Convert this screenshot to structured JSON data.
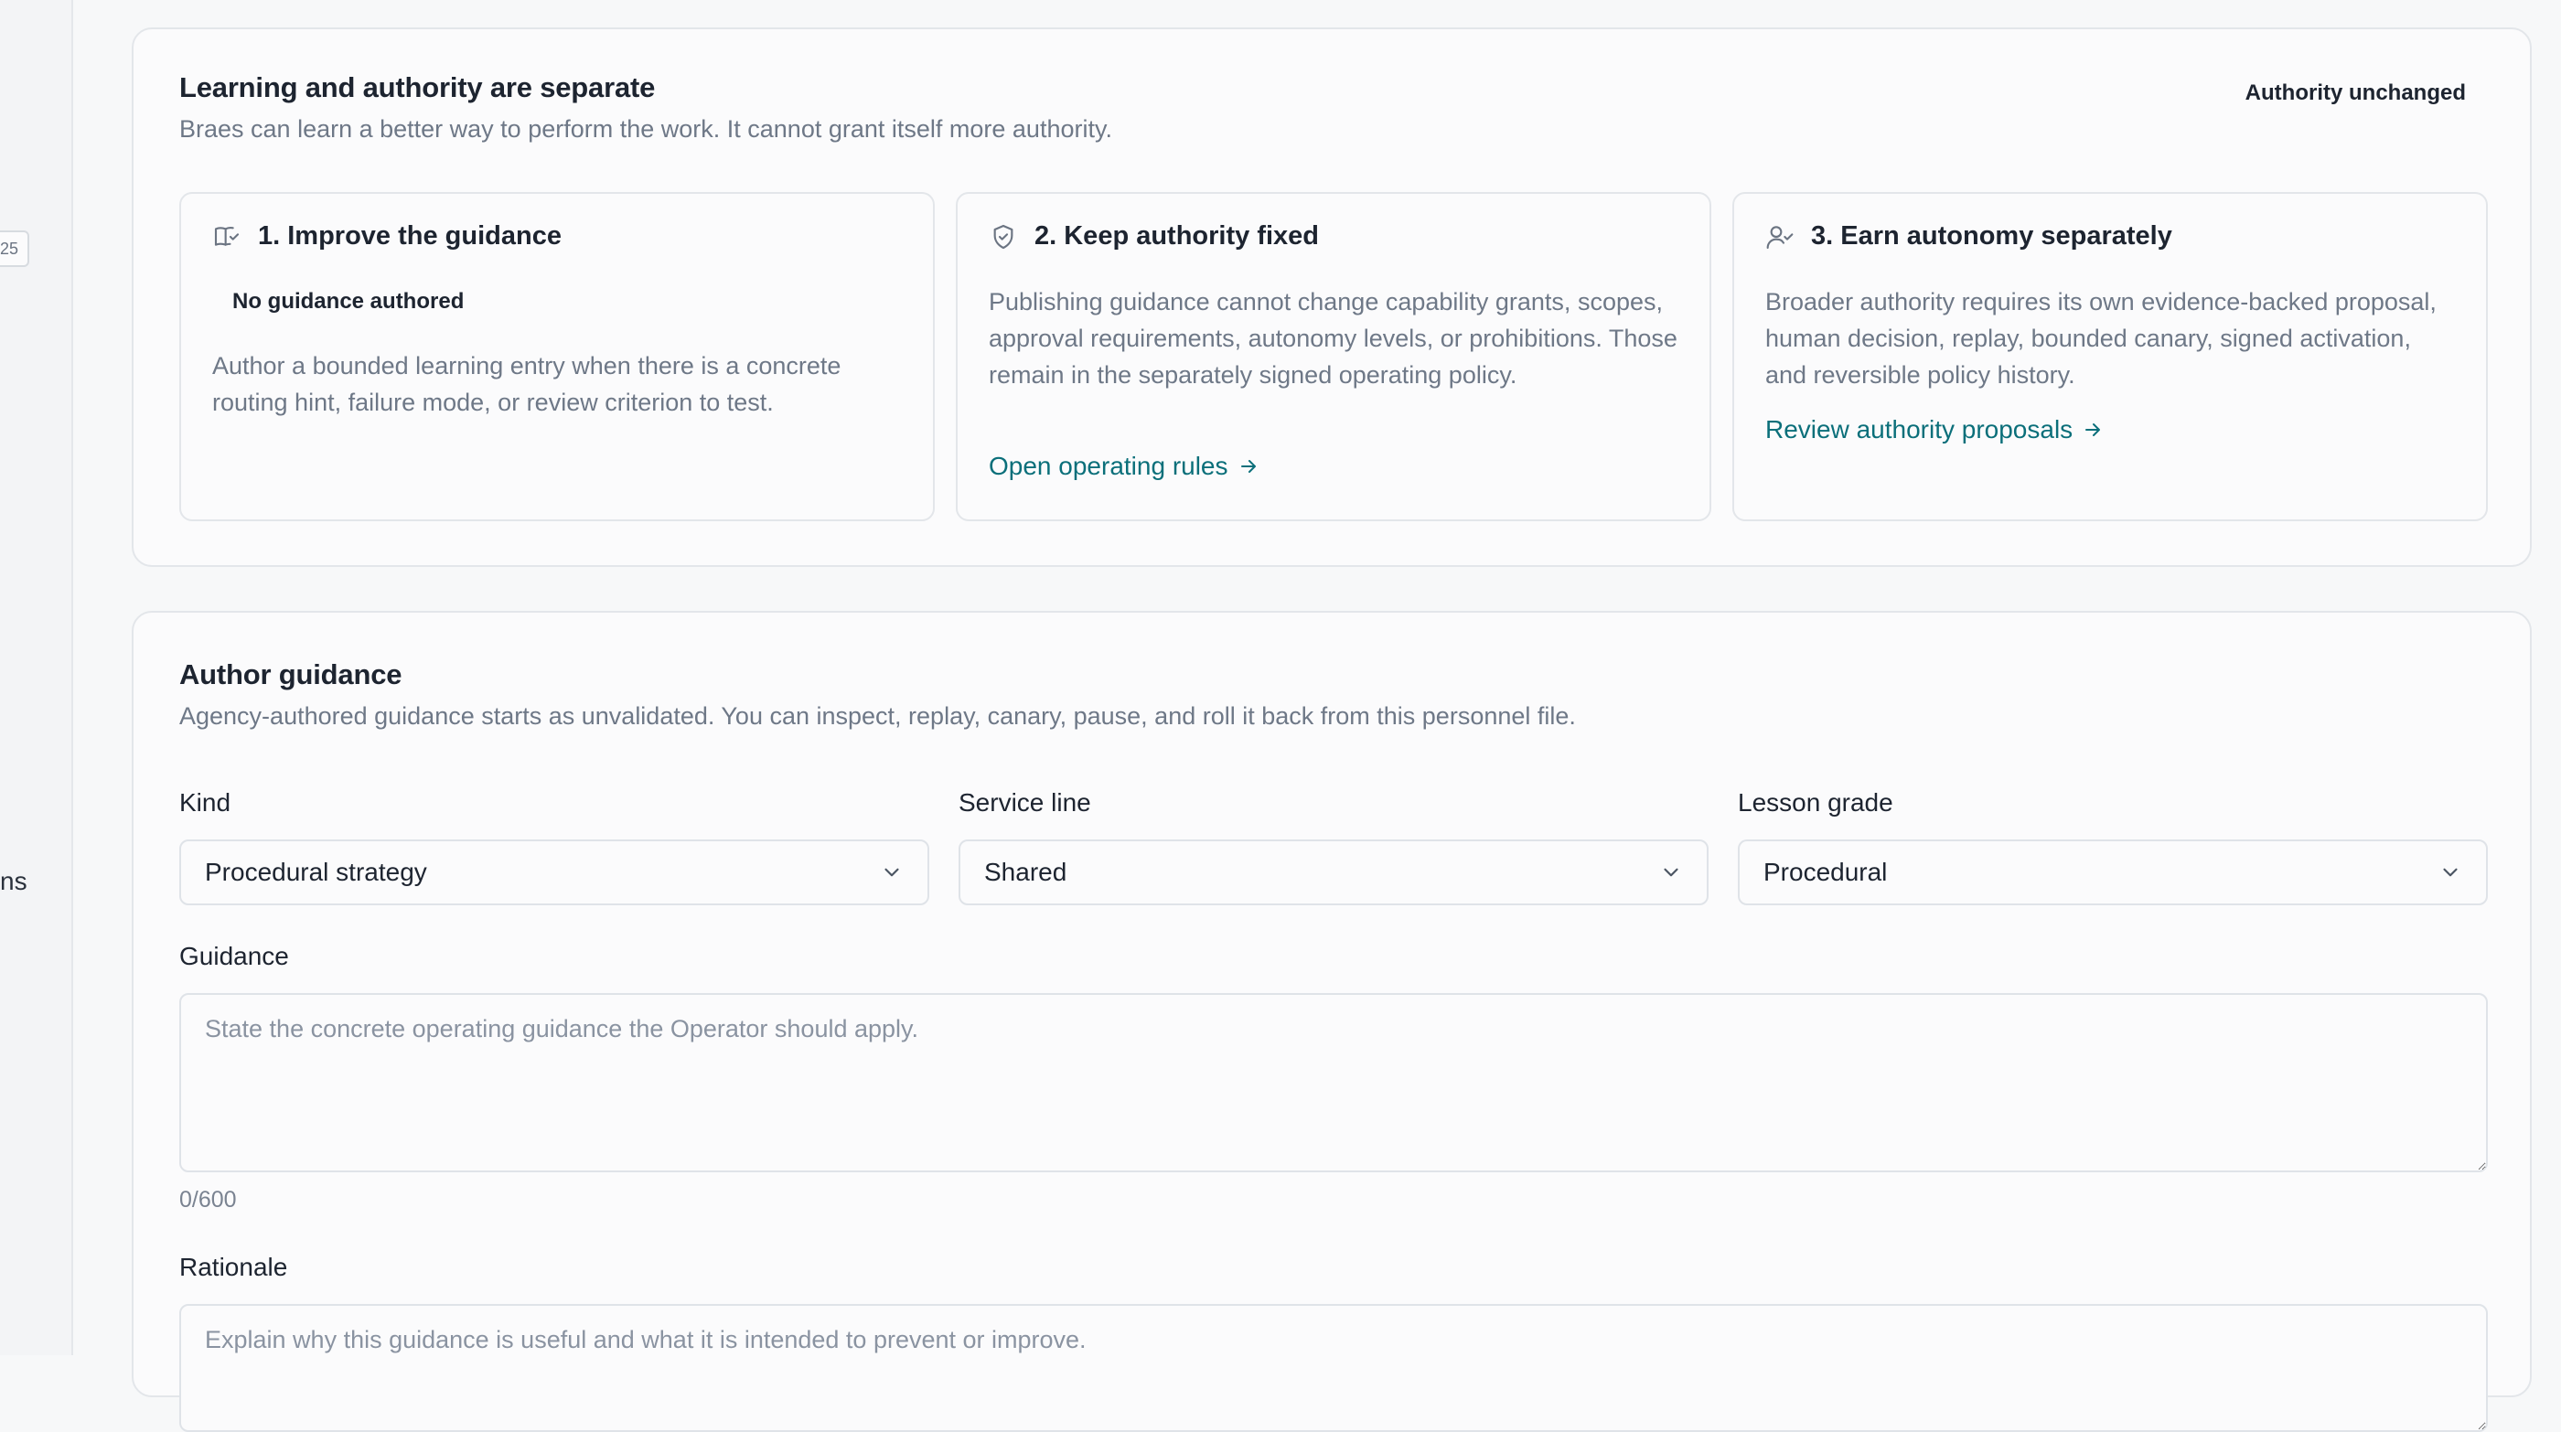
{
  "sidebar": {
    "badge_text": "25",
    "fragment_text": "ns"
  },
  "separation": {
    "title": "Learning and authority are separate",
    "subtitle": "Braes can learn a better way to perform the work. It cannot grant itself more authority.",
    "status": "Authority unchanged",
    "steps": [
      {
        "icon": "book-check-icon",
        "title": "1. Improve the guidance",
        "tag": "No guidance authored",
        "body": "Author a bounded learning entry when there is a concrete routing hint, failure mode, or review criterion to test."
      },
      {
        "icon": "shield-check-icon",
        "title": "2. Keep authority fixed",
        "body": "Publishing guidance cannot change capability grants, scopes, approval requirements, autonomy levels, or prohibitions. Those remain in the separately signed operating policy.",
        "link": "Open operating rules"
      },
      {
        "icon": "user-check-icon",
        "title": "3. Earn autonomy separately",
        "body": "Broader authority requires its own evidence-backed proposal, human decision, replay, bounded canary, signed activation, and reversible policy history.",
        "link": "Review authority proposals"
      }
    ]
  },
  "author": {
    "title": "Author guidance",
    "subtitle": "Agency-authored guidance starts as unvalidated. You can inspect, replay, canary, pause, and roll it back from this personnel file.",
    "kind_label": "Kind",
    "kind_value": "Procedural strategy",
    "service_label": "Service line",
    "service_value": "Shared",
    "grade_label": "Lesson grade",
    "grade_value": "Procedural",
    "guidance_label": "Guidance",
    "guidance_placeholder": "State the concrete operating guidance the Operator should apply.",
    "guidance_counter": "0/600",
    "rationale_label": "Rationale",
    "rationale_placeholder": "Explain why this guidance is useful and what it is intended to prevent or improve."
  },
  "colors": {
    "accent": "#0b6f7a",
    "text": "#1d2430",
    "muted": "#6e7887",
    "border": "#e3e6ea"
  }
}
